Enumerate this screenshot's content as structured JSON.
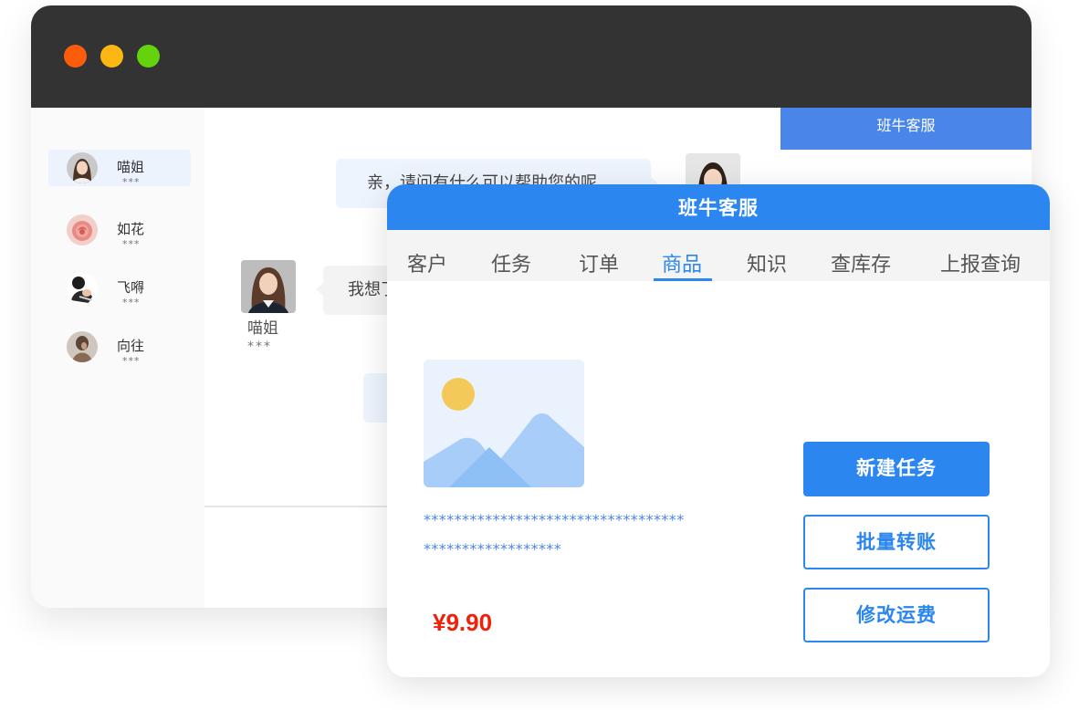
{
  "colors": {
    "titlebar": "#333333",
    "close_dot": "#fd5d0a",
    "minimize_dot": "#fdb712",
    "maximize_dot": "#62d30c",
    "brand_blue": "#2b86f0",
    "price_red": "#f0210a"
  },
  "sidebar": {
    "contacts": [
      {
        "name": "喵姐",
        "sub": "***",
        "avatar_icon": "woman-portrait-icon"
      },
      {
        "name": "如花",
        "sub": "***",
        "avatar_icon": "rose-flower-icon"
      },
      {
        "name": "飞嘚",
        "sub": "***",
        "avatar_icon": "person-photo-icon"
      },
      {
        "name": "向往",
        "sub": "***",
        "avatar_icon": "person-photo-icon"
      }
    ]
  },
  "chat": {
    "agent_message": "亲，请问有什么可以帮助您的呢",
    "customer_message": "我想了",
    "customer_name": "喵姐",
    "customer_sub": "***"
  },
  "back_panel": {
    "title": "班牛客服"
  },
  "card": {
    "title": "班牛客服",
    "tabs": [
      "客户",
      "任务",
      "订单",
      "商品",
      "知识",
      "查库存",
      "上报查询"
    ],
    "active_tab": "商品",
    "product_image_icon": "image-placeholder-icon",
    "description_line1": "**********************************",
    "description_line2": "******************",
    "price": "¥9.90",
    "buttons": {
      "new_task": "新建任务",
      "batch_transfer": "批量转账",
      "modify_shipping": "修改运费"
    }
  }
}
